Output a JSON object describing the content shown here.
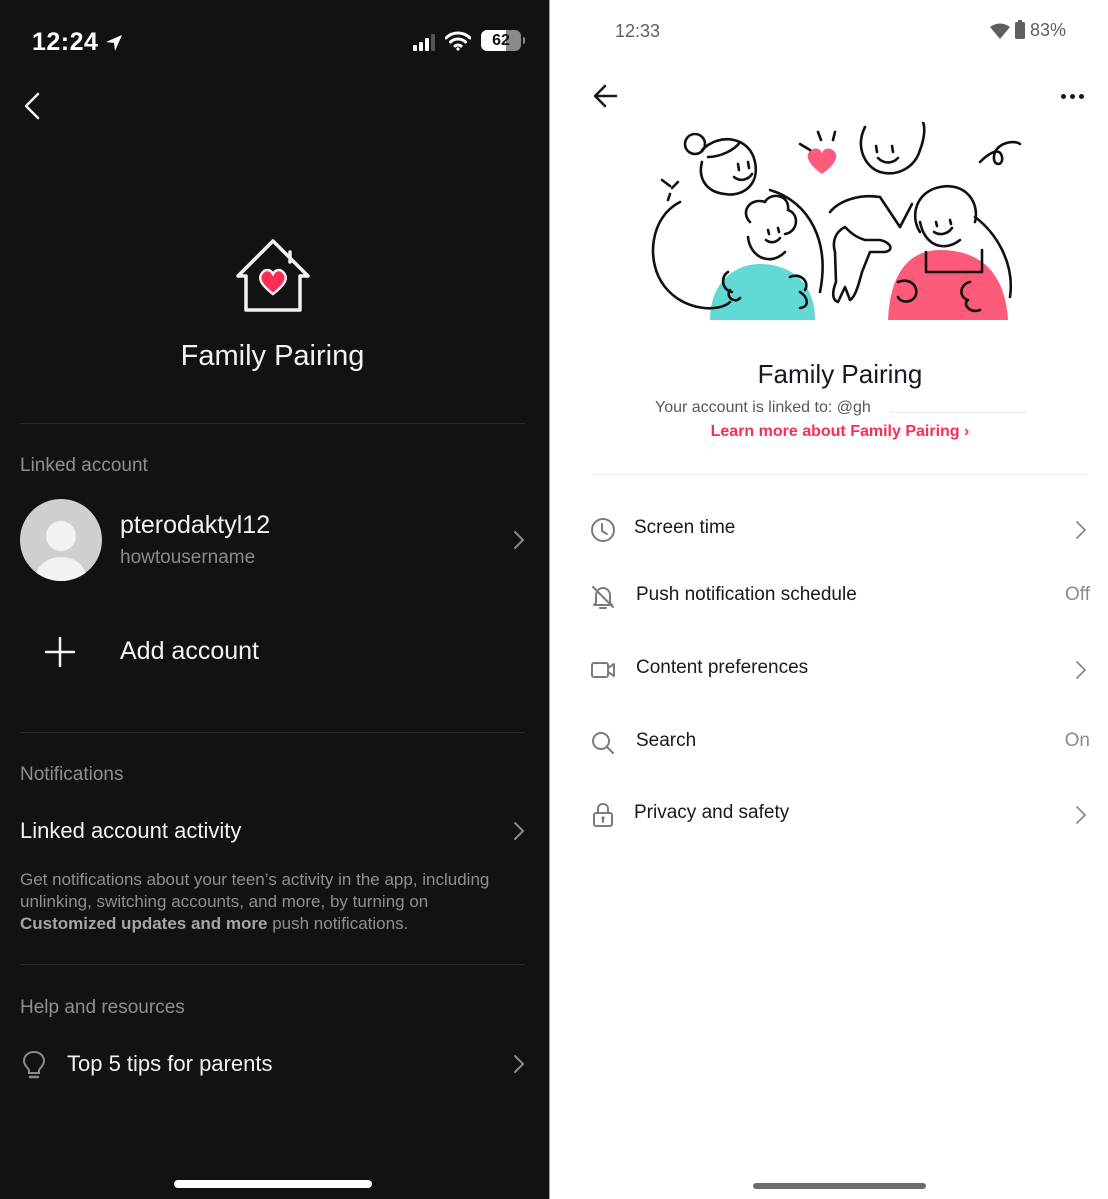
{
  "left_screen": {
    "status_bar": {
      "time": "12:24",
      "battery_percent": "62",
      "icons": [
        "location-arrow-icon",
        "cellular-signal-icon",
        "wifi-icon",
        "battery-icon"
      ]
    },
    "back_icon": "chevron-left-icon",
    "header": {
      "icon": "house-heart-icon",
      "title": "Family Pairing"
    },
    "linked_account": {
      "section_label": "Linked account",
      "account": {
        "display_name": "pterodaktyl12",
        "username": "howtousername"
      },
      "add_account_label": "Add account"
    },
    "notifications": {
      "section_label": "Notifications",
      "item_title": "Linked account activity",
      "description_prefix": "Get notifications about your teen’s activity in the app, including unlinking, switching accounts, and more, by turning on ",
      "description_bold": "Customized updates and more",
      "description_suffix": " push notifications."
    },
    "help": {
      "section_label": "Help and resources",
      "item_label": "Top 5 tips for parents",
      "item_icon": "lightbulb-icon"
    }
  },
  "right_screen": {
    "status_bar": {
      "time": "12:33",
      "battery_percent": "83%",
      "icons": [
        "wifi-icon",
        "battery-icon"
      ]
    },
    "nav": {
      "back_icon": "arrow-left-icon",
      "more_icon": "more-horizontal-icon"
    },
    "header": {
      "illustration": "family-illustration",
      "title": "Family Pairing",
      "linked_to_text": "Your account is linked to: @gh",
      "learn_more_label": "Learn more about Family Pairing",
      "learn_more_chevron": "›"
    },
    "colors": {
      "accent": "#fe2c55",
      "teal": "#63d9d6",
      "pink": "#fe5a7a"
    },
    "settings": [
      {
        "icon": "clock-icon",
        "label": "Screen time",
        "value": null,
        "chevron": true
      },
      {
        "icon": "bell-off-icon",
        "label": "Push notification schedule",
        "value": "Off",
        "chevron": false
      },
      {
        "icon": "video-camera-icon",
        "label": "Content preferences",
        "value": null,
        "chevron": true
      },
      {
        "icon": "search-icon",
        "label": "Search",
        "value": "On",
        "chevron": false
      },
      {
        "icon": "lock-icon",
        "label": "Privacy and safety",
        "value": null,
        "chevron": true
      }
    ]
  }
}
